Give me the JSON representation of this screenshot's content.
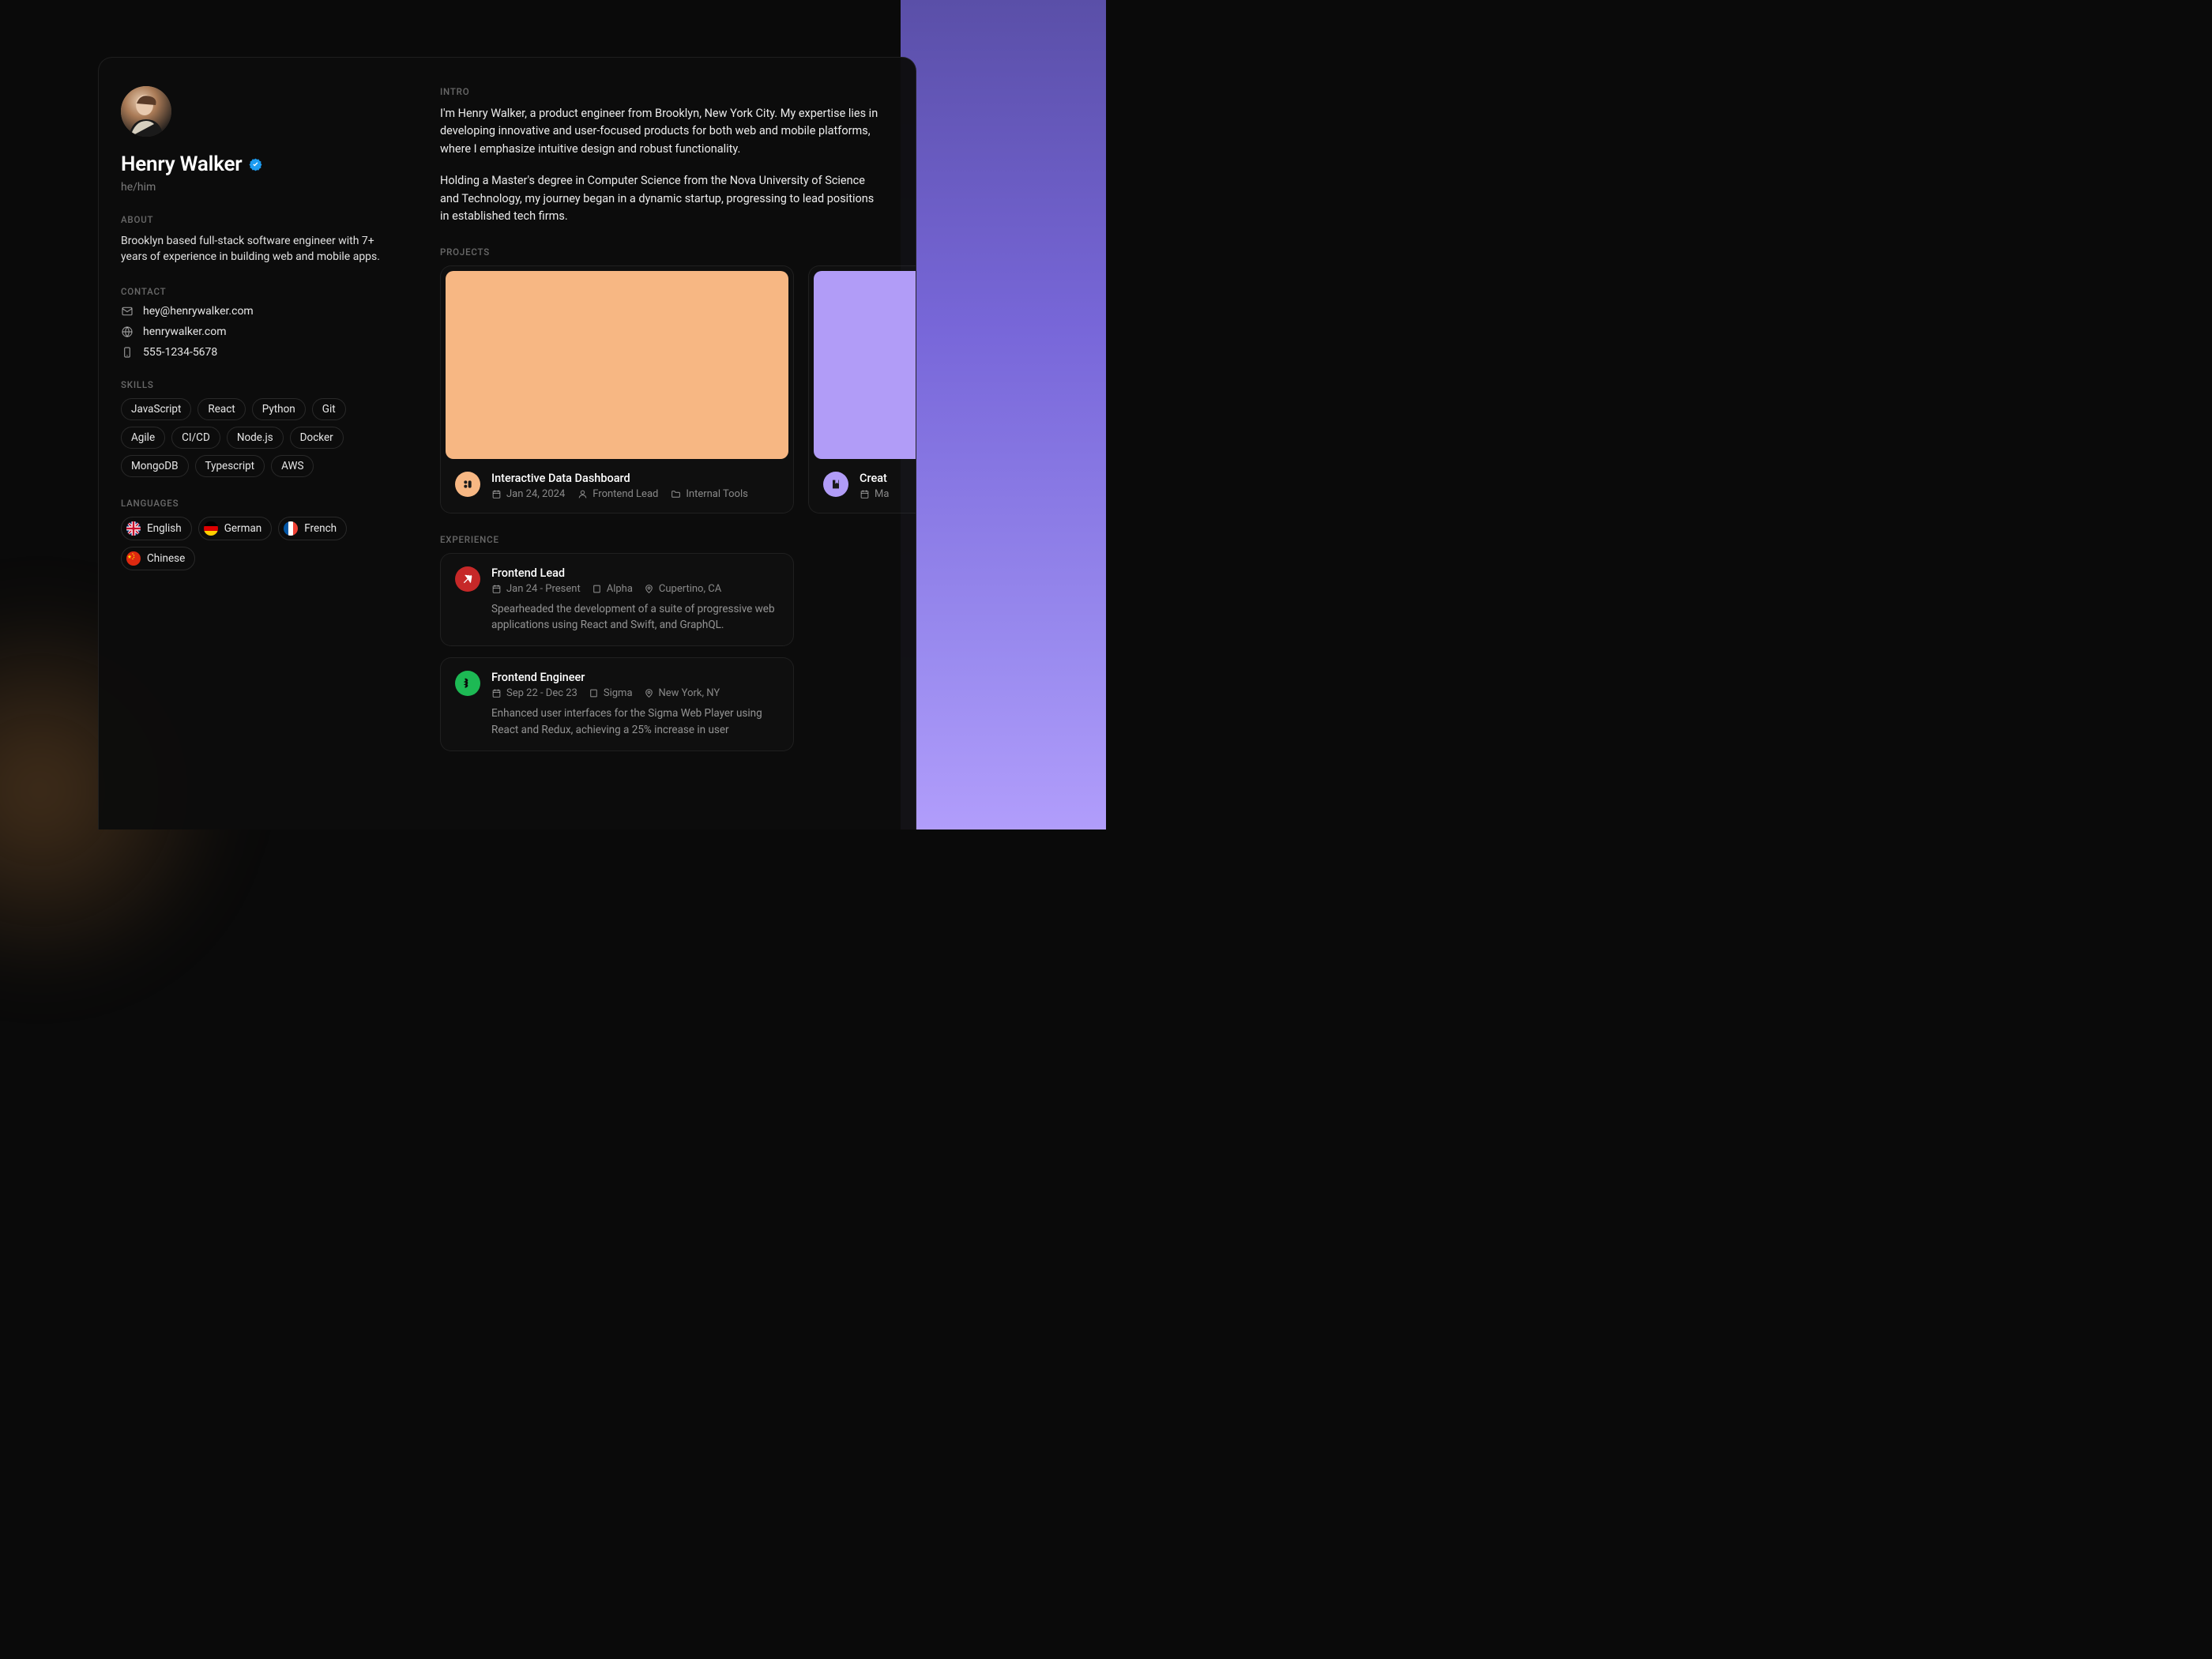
{
  "profile": {
    "name": "Henry Walker",
    "pronouns": "he/him"
  },
  "sections": {
    "about": "ABOUT",
    "contact": "CONTACT",
    "skills": "SKILLS",
    "languages": "LANGUAGES",
    "intro": "INTRO",
    "projects": "PROJECTS",
    "experience": "EXPERIENCE"
  },
  "about": "Brooklyn based full-stack software engineer with 7+ years of experience in building web and mobile apps.",
  "contact": {
    "email": "hey@henrywalker.com",
    "website": "henrywalker.com",
    "phone": "555-1234-5678"
  },
  "skills": [
    "JavaScript",
    "React",
    "Python",
    "Git",
    "Agile",
    "CI/CD",
    "Node.js",
    "Docker",
    "MongoDB",
    "Typescript",
    "AWS"
  ],
  "languages": [
    {
      "name": "English",
      "flag": "uk"
    },
    {
      "name": "German",
      "flag": "de"
    },
    {
      "name": "French",
      "flag": "fr"
    },
    {
      "name": "Chinese",
      "flag": "cn"
    }
  ],
  "intro": {
    "p1": "I'm Henry Walker, a product engineer from Brooklyn, New York City. My expertise lies in developing innovative and user-focused products for both web and mobile platforms, where I emphasize intuitive design and robust functionality.",
    "p2": "Holding a Master's degree in Computer Science from the Nova University of Science and Technology, my journey began in a dynamic startup, progressing to lead positions in established tech firms."
  },
  "projects": [
    {
      "title": "Interactive Data Dashboard",
      "date": "Jan 24, 2024",
      "role": "Frontend Lead",
      "category": "Internal Tools",
      "color": "orange"
    },
    {
      "title": "Creat",
      "date": "Ma",
      "role": "",
      "category": "",
      "color": "purple"
    }
  ],
  "experience": [
    {
      "title": "Frontend Lead",
      "dates": "Jan 24 - Present",
      "company": "Alpha",
      "location": "Cupertino, CA",
      "desc": "Spearheaded the development of a suite of progressive web applications using React and Swift, and GraphQL.",
      "color": "red"
    },
    {
      "title": "Frontend Engineer",
      "dates": "Sep 22 - Dec 23",
      "company": "Sigma",
      "location": "New York, NY",
      "desc": "Enhanced user interfaces for the Sigma Web Player using React and Redux, achieving a 25% increase in user",
      "color": "green"
    }
  ],
  "colors": {
    "orange": "#f7b783",
    "purple": "#b19cf7",
    "red": "#c62828",
    "green": "#1db954",
    "verified": "#1d9bf0"
  }
}
